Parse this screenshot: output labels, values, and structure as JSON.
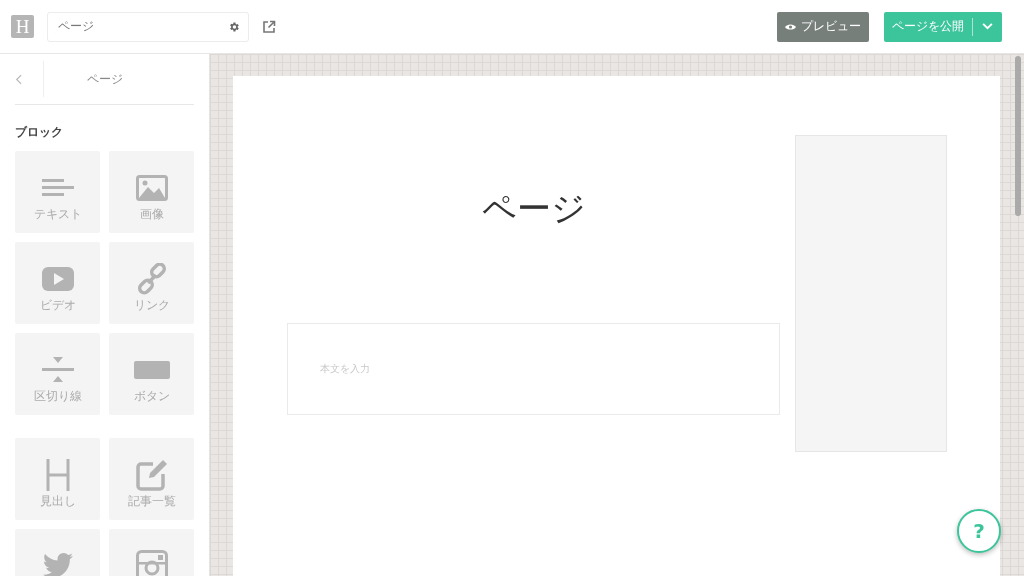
{
  "topbar": {
    "logo": "H",
    "page_name": "ページ",
    "preview_button": "プレビュー",
    "publish_button": "ページを公開"
  },
  "sidebar": {
    "title": "ページ",
    "section": "ブロック",
    "block_groups": [
      [
        {
          "kind": "text",
          "label": "テキスト"
        },
        {
          "kind": "image",
          "label": "画像"
        },
        {
          "kind": "video",
          "label": "ビデオ"
        },
        {
          "kind": "link",
          "label": "リンク"
        },
        {
          "kind": "divider",
          "label": "区切り線"
        },
        {
          "kind": "button",
          "label": "ボタン"
        }
      ],
      [
        {
          "kind": "heading",
          "label": "見出し"
        },
        {
          "kind": "post-list",
          "label": "記事一覧"
        },
        {
          "kind": "twitter"
        },
        {
          "kind": "instagram"
        }
      ]
    ]
  },
  "canvas": {
    "page_title": "ページ",
    "body_placeholder": "本文を入力"
  },
  "help_button": "?"
}
